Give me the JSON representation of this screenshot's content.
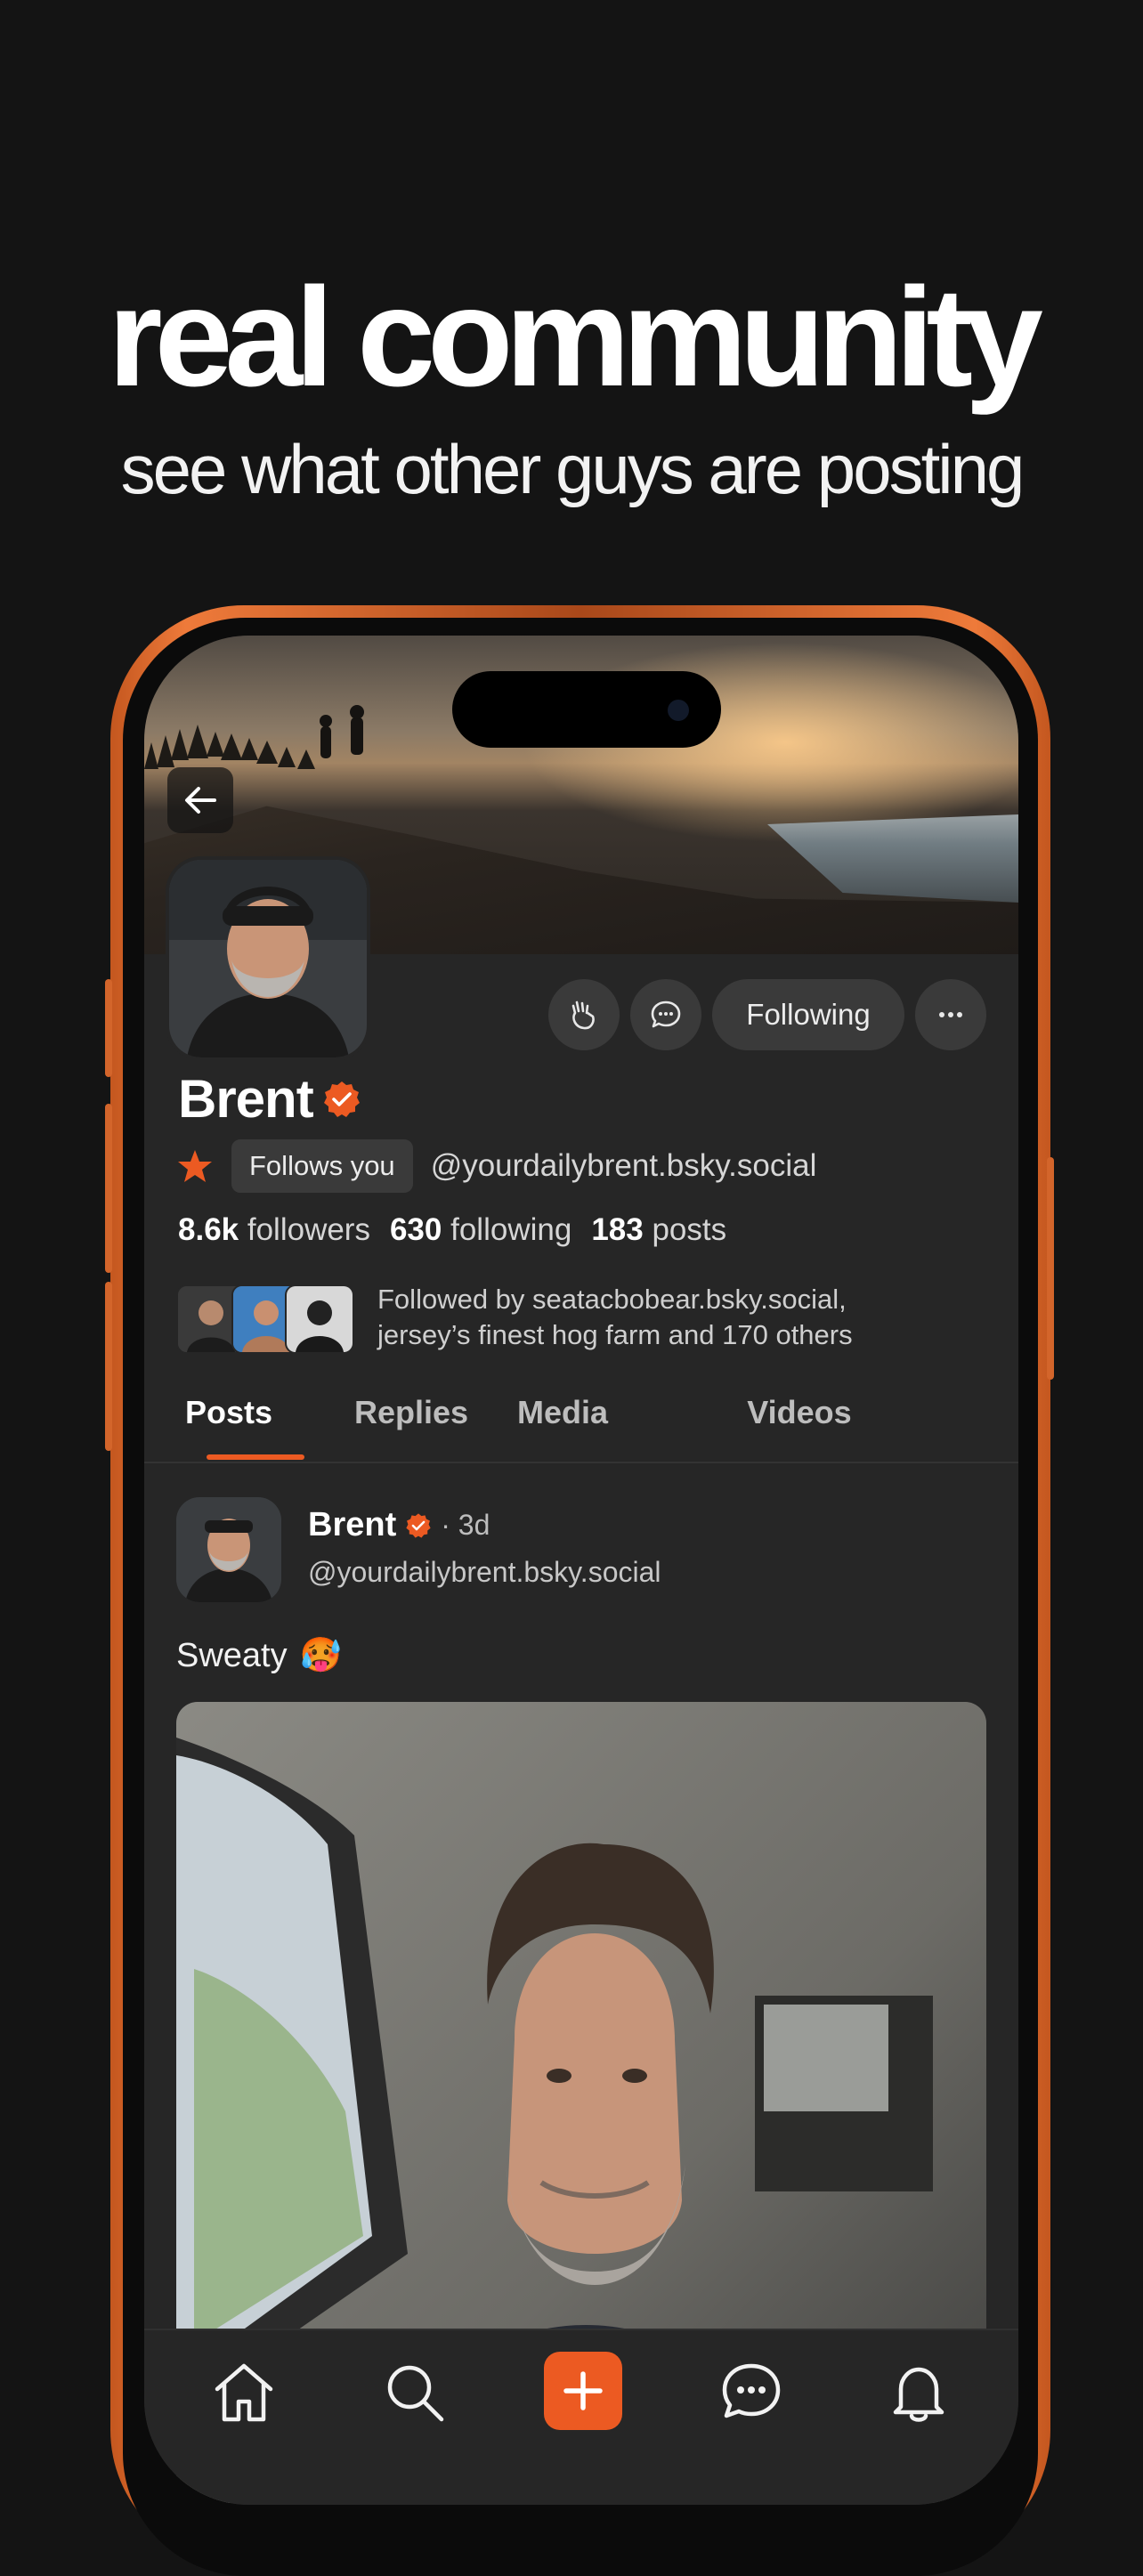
{
  "promo": {
    "headline": "real community",
    "subheadline": "see what other guys are posting"
  },
  "profile": {
    "name": "Brent",
    "verified": true,
    "follows_you_label": "Follows you",
    "handle": "@yourdailybrent.bsky.social",
    "followers_count": "8.6k",
    "followers_label": "followers",
    "following_count": "630",
    "following_label": "following",
    "posts_count": "183",
    "posts_label": "posts",
    "followed_by_text": "Followed by seatacbobear.bsky.social, jersey’s finest hog farm and 170 others",
    "following_button_label": "Following"
  },
  "tabs": [
    {
      "label": "Posts",
      "active": true
    },
    {
      "label": "Replies",
      "active": false
    },
    {
      "label": "Media",
      "active": false
    },
    {
      "label": "Videos",
      "active": false
    }
  ],
  "post": {
    "author": "Brent",
    "time": "· 3d",
    "handle": "@yourdailybrent.bsky.social",
    "text": "Sweaty",
    "emoji": "🥵"
  },
  "tabbar": {
    "items": [
      "home-icon",
      "search-icon",
      "compose-icon",
      "chat-icon",
      "bell-icon"
    ]
  },
  "colors": {
    "accent": "#ec5a22",
    "background": "#141414",
    "screen": "#262626",
    "frame": "#ee7a3a"
  }
}
